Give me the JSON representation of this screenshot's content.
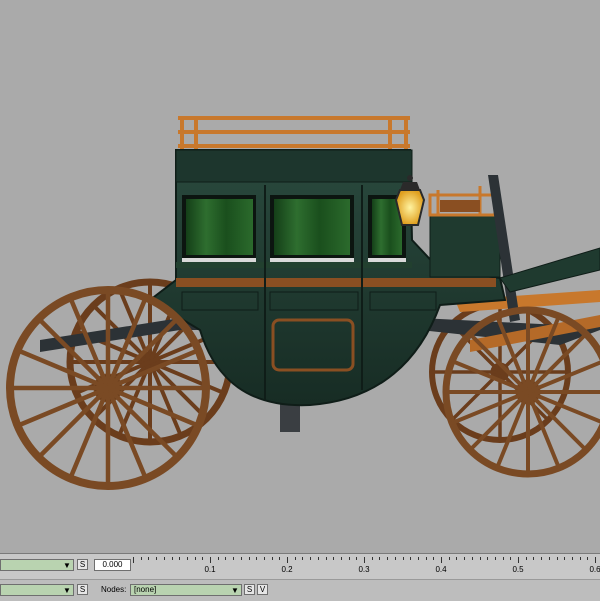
{
  "timeline": {
    "time_value": "0.000",
    "ruler_labels": [
      "0.1",
      "0.2",
      "0.3",
      "0.4",
      "0.5",
      "0.6"
    ],
    "button_s": "S",
    "button_v": "V",
    "nodes_label": "Nodes:",
    "nodes_value": "[none]"
  },
  "icons": {
    "dropdown": "chevron-down-icon"
  },
  "colors": {
    "carriage_body": "#1f3a2f",
    "curtains": "#1f5a24",
    "wood": "#7a4a24",
    "brass": "#c8782c",
    "lamp": "#f2c23a",
    "background": "#aaaaaa"
  }
}
